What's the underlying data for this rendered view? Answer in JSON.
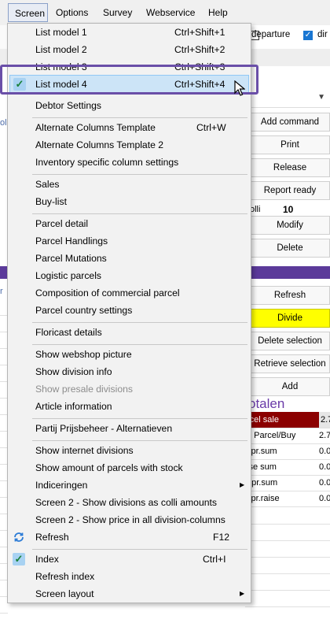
{
  "menubar": {
    "items": [
      "Screen",
      "Options",
      "Survey",
      "Webservice",
      "Help"
    ]
  },
  "background": {
    "departure_label": "departure",
    "right_check_label": "dir",
    "left_labels": [
      "ol",
      "r"
    ],
    "buttons": {
      "add_command": "Add command",
      "print": "Print",
      "release": "Release",
      "report_ready": "Report ready",
      "modify": "Modify",
      "delete": "Delete",
      "refresh": "Refresh",
      "divide": "Divide",
      "delete_selection": "Delete selection",
      "retrieve_selection": "Retrieve selection",
      "add": "Add"
    },
    "colli_label": "olli",
    "colli_value": "10",
    "totals_title": "otalen",
    "totals_rows": [
      {
        "key": "rcel sale",
        "value": "2.7"
      },
      {
        "key": "f. Parcel/Buy",
        "value": "2.7"
      },
      {
        "key": "ypr.sum",
        "value": "0.0"
      },
      {
        "key": "ise sum",
        "value": "0.0"
      },
      {
        "key": "epr.sum",
        "value": "0.0"
      },
      {
        "key": "ypr.raise",
        "value": "0.0"
      }
    ]
  },
  "menu": {
    "items": [
      {
        "label": "List model 1",
        "shortcut": "Ctrl+Shift+1"
      },
      {
        "label": "List model 2",
        "shortcut": "Ctrl+Shift+2"
      },
      {
        "label": "List model 3",
        "shortcut": "Ctrl+Shift+3"
      },
      {
        "label": "List model 4",
        "shortcut": "Ctrl+Shift+4",
        "checked": true,
        "hovered": true
      },
      {
        "label": "Debtor Settings",
        "shortcut": ""
      },
      {
        "label": "Alternate Columns Template",
        "shortcut": "Ctrl+W"
      },
      {
        "label": "Alternate Columns Template 2",
        "shortcut": ""
      },
      {
        "label": "Inventory specific column settings",
        "shortcut": ""
      },
      {
        "label": "Sales",
        "shortcut": ""
      },
      {
        "label": "Buy-list",
        "shortcut": ""
      },
      {
        "label": "Parcel detail",
        "shortcut": ""
      },
      {
        "label": "Parcel Handlings",
        "shortcut": ""
      },
      {
        "label": "Parcel Mutations",
        "shortcut": ""
      },
      {
        "label": "Logistic parcels",
        "shortcut": ""
      },
      {
        "label": "Composition of commercial parcel",
        "shortcut": ""
      },
      {
        "label": "Parcel country settings",
        "shortcut": ""
      },
      {
        "label": "Floricast details",
        "shortcut": ""
      },
      {
        "label": "Show webshop picture",
        "shortcut": ""
      },
      {
        "label": "Show division info",
        "shortcut": ""
      },
      {
        "label": "Show presale divisions",
        "shortcut": "",
        "disabled": true
      },
      {
        "label": "Article information",
        "shortcut": ""
      },
      {
        "label": "Partij Prijsbeheer - Alternatieven",
        "shortcut": ""
      },
      {
        "label": "Show internet divisions",
        "shortcut": ""
      },
      {
        "label": "Show amount of parcels with stock",
        "shortcut": ""
      },
      {
        "label": "Indiceringen",
        "shortcut": "",
        "submenu": true
      },
      {
        "label": "Screen 2 - Show divisions as colli amounts",
        "shortcut": ""
      },
      {
        "label": "Screen 2 - Show price in all division-columns",
        "shortcut": ""
      },
      {
        "label": "Refresh",
        "shortcut": "F12",
        "icon": "refresh-icon"
      },
      {
        "label": "Index",
        "shortcut": "Ctrl+I",
        "checked": true
      },
      {
        "label": "Refresh index",
        "shortcut": ""
      },
      {
        "label": "Screen layout",
        "shortcut": "",
        "submenu": true
      }
    ]
  },
  "colors": {
    "selection_bg": "#cce4f7",
    "highlight_outline": "#6a4fa8",
    "divide_button": "#ffff00",
    "purple_band": "#5b3a9a",
    "totals_header": "#8b0000"
  }
}
